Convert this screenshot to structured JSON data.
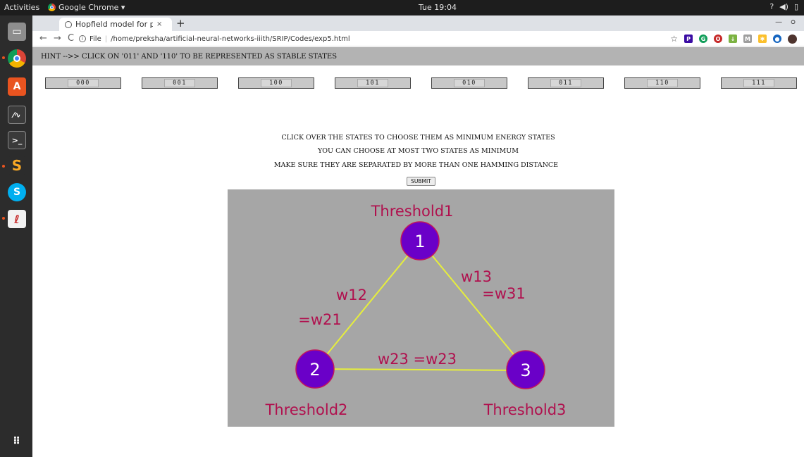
{
  "system_bar": {
    "activities": "Activities",
    "app_name": "Google Chrome ▾",
    "clock": "Tue 19:04"
  },
  "browser": {
    "tab_title": "Hopfield model for patte",
    "tab_close": "×",
    "new_tab": "+",
    "info_label": "File",
    "url": "/home/preksha/artificial-neural-networks-iiith/SRIP/Codes/exp5.html"
  },
  "page": {
    "hint": "HINT -->> CLICK ON '011' AND '110' TO BE REPRESENTED AS STABLE STATES",
    "states": [
      "000",
      "001",
      "100",
      "101",
      "010",
      "011",
      "110",
      "111"
    ],
    "instructions": [
      "CLICK OVER THE STATES TO CHOOSE THEM AS MINIMUM ENERGY STATES",
      "YOU CAN CHOOSE AT MOST TWO STATES AS MINIMUM",
      "MAKE SURE THEY ARE SEPARATED BY MORE THAN ONE HAMMING DISTANCE"
    ],
    "submit_label": "SUBMIT"
  },
  "diagram": {
    "threshold1": "Threshold1",
    "threshold2": "Threshold2",
    "threshold3": "Threshold3",
    "node1": "1",
    "node2": "2",
    "node3": "3",
    "w12": "w12",
    "w21": "=w21",
    "w13": "w13",
    "w31": "=w31",
    "w23": "w23 =w23",
    "colors": {
      "background": "#a6a6a6",
      "node_fill": "#6a00c8",
      "edge": "#e6ee3c",
      "label": "#b0104e"
    }
  }
}
